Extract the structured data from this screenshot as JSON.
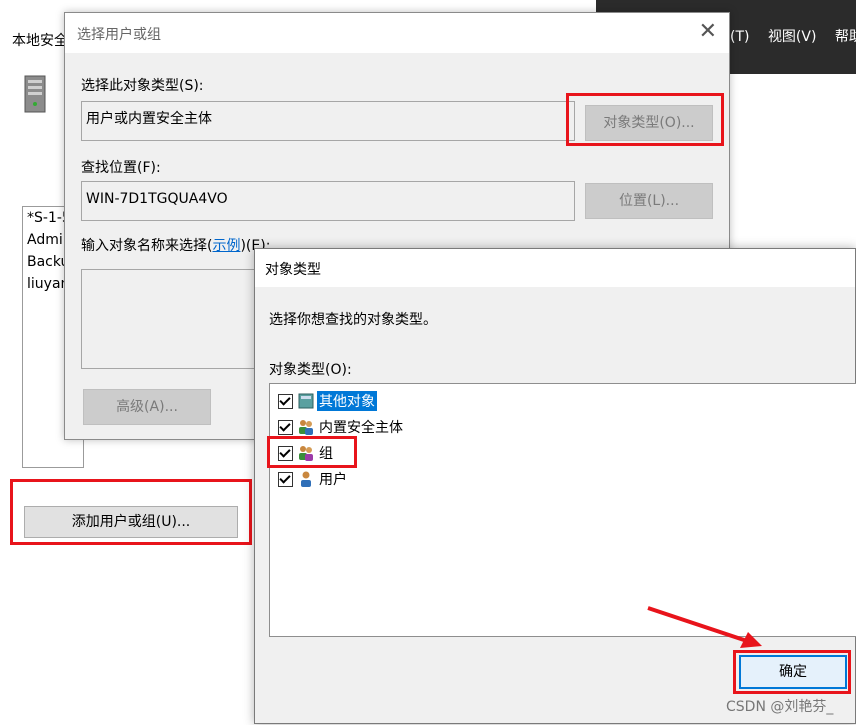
{
  "background_app": {
    "menu": [
      "(T)",
      "视图(V)",
      "帮助"
    ]
  },
  "local_policy": {
    "title": "本地安全",
    "list_items": [
      "*S-1-5",
      "Admi",
      "Backu",
      "liuyan"
    ],
    "add_button": "添加用户或组(U)..."
  },
  "select_dialog": {
    "title": "选择用户或组",
    "object_type_label": "选择此对象类型(S):",
    "object_type_value": "用户或内置安全主体",
    "object_type_button": "对象类型(O)...",
    "location_label": "查找位置(F):",
    "location_value": "WIN-7D1TGQUA4VO",
    "location_button": "位置(L)...",
    "names_label_prefix": "输入对象名称来选择(",
    "names_label_link": "示例",
    "names_label_suffix": ")(E):",
    "advanced_button": "高级(A)..."
  },
  "object_types_dialog": {
    "title": "对象类型",
    "description": "选择你想查找的对象类型。",
    "list_label": "对象类型(O):",
    "items": [
      {
        "label": "其他对象",
        "checked": true,
        "selected": true,
        "icon": "other-objects-icon"
      },
      {
        "label": "内置安全主体",
        "checked": true,
        "selected": false,
        "icon": "security-principal-icon"
      },
      {
        "label": "组",
        "checked": true,
        "selected": false,
        "icon": "group-icon"
      },
      {
        "label": "用户",
        "checked": true,
        "selected": false,
        "icon": "user-icon"
      }
    ],
    "ok_button": "确定"
  },
  "watermark": "CSDN @刘艳芬_",
  "colors": {
    "highlight": "#e8141b",
    "selection": "#0078d7",
    "dialog_bg": "#f0f0f0"
  }
}
